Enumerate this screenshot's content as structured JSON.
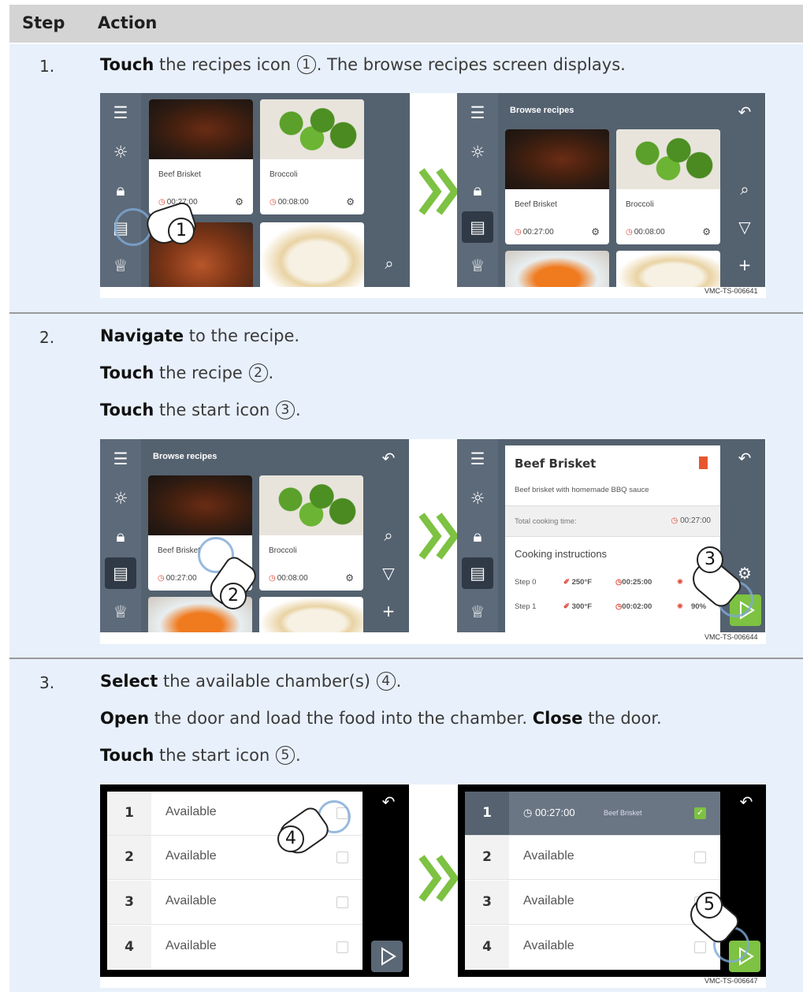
{
  "header": {
    "col_step": "Step",
    "col_action": "Action"
  },
  "steps": [
    {
      "number": "1.",
      "lines": [
        {
          "bold": "Touch",
          "text": " the recipes icon ",
          "ref": "1",
          "after": ". The browse recipes screen displays."
        }
      ],
      "figure_id": "VMC-TS-006641"
    },
    {
      "number": "2.",
      "lines": [
        {
          "bold": "Navigate",
          "text": " to the recipe.",
          "ref": "",
          "after": ""
        },
        {
          "bold": "Touch",
          "text": " the recipe ",
          "ref": "2",
          "after": "."
        },
        {
          "bold": "Touch",
          "text": " the start icon ",
          "ref": "3",
          "after": "."
        }
      ],
      "figure_id": "VMC-TS-006644"
    },
    {
      "number": "3.",
      "lines": [
        {
          "bold": "Select",
          "text": " the available chamber(s) ",
          "ref": "4",
          "after": "."
        },
        {
          "bold": "Open",
          "text": " the door and load the food into the chamber. ",
          "bold2": "Close",
          "after2": " the door."
        },
        {
          "bold": "Touch",
          "text": " the start icon ",
          "ref": "5",
          "after": "."
        }
      ],
      "figure_id": "VMC-TS-006647"
    }
  ],
  "ui": {
    "browse_title": "Browse recipes",
    "recipes": [
      {
        "name": "Beef Brisket",
        "time": "00:27:00"
      },
      {
        "name": "Broccoli",
        "time": "00:08:00"
      }
    ],
    "detail": {
      "title": "Beef Brisket",
      "subtitle": "Beef brisket with homemade BBQ sauce",
      "total_label": "Total cooking time:",
      "total_time": "00:27:00",
      "instructions_label": "Cooking instructions",
      "steps": [
        {
          "name": "Step 0",
          "temp": "250°F",
          "time": "00:25:00",
          "fan": ""
        },
        {
          "name": "Step 1",
          "temp": "300°F",
          "time": "00:02:00",
          "fan": "90%"
        }
      ]
    },
    "chambers": [
      {
        "num": "1",
        "status": "Available"
      },
      {
        "num": "2",
        "status": "Available"
      },
      {
        "num": "3",
        "status": "Available"
      },
      {
        "num": "4",
        "status": "Available"
      }
    ],
    "chamber1_selected": {
      "time": "00:27:00",
      "recipe": "Beef Brisket"
    },
    "accent_green": "#7dc242",
    "panel_color": "#54616f"
  }
}
